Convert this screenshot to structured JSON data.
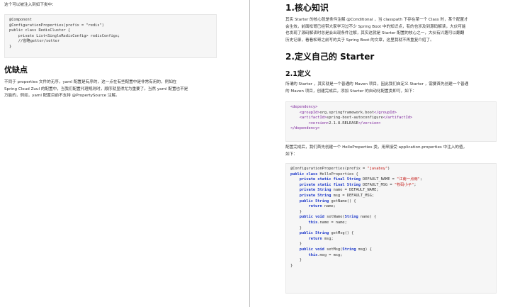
{
  "left": {
    "intro": "这个可以被注入到如下类中：",
    "code1": [
      "@Component",
      "@ConfigurationProperties(prefix = \"redis\")",
      "public class RedisCluster {",
      "    private List<SingleRedisConfig> redisConfigs;",
      "    //省略getter/setter",
      "}"
    ],
    "heading": "优缺点",
    "para_lines": [
      "不同于 properties 文件的无序，yaml 配置是有序的，这一点在有些配置中是非常有用的，例如在",
      "Spring Cloud Zuul 的配置中，当我们配置代理规则时，顺序就显得尤为重要了。当然 yaml 配置也不是",
      "万能的，例如，yaml 配置目前不支持 @PropertySource 注解。"
    ]
  },
  "right": {
    "h1_core": "1.核心知识",
    "core_lines": [
      "其实 Starter 的核心就是条件注解 @Conditional ，当 classpath 下存在某一个 Class 时，某个配置才",
      "会生效，前面松哥已经带大家学习过不少 Spring Boot 中的知识点，有的也涉及到源码解读，大伙可能",
      "也发现了源码解读时总是会出现条件注解，其实这就是 Starter 配置的核心之一，大伙有兴趣可以翻翻",
      "历史记录，看看松哥之前写的关于 Spring Boot 的文章，这里我就不再重复介绍了。"
    ],
    "h2_define": "2.定义自己的 Starter",
    "h3_define": "2.1定义",
    "define_lines": [
      "所谓的 Starter ，其实就是一个普通的 Maven 项目，因此我们自定义 Starter ，需要首先创建一个普通",
      "的 Maven 项目，创建完成后，添加 Starter 的自动化配置类即可，如下："
    ],
    "dep": {
      "open": "<dependency>",
      "close": "</dependency>",
      "groupId_open": "<groupId>",
      "groupId_value": "org.springframework.boot",
      "groupId_close": "</groupId>",
      "artifactId_open": "<artifactId>",
      "artifactId_value": "spring-boot-autoconfigure",
      "artifactId_close": "</artifactId>",
      "version_open": "<version>",
      "version_value": "2.1.8.RELEASE",
      "version_close": "</version>"
    },
    "after_lines": [
      "配置完成后，我们首先创建一个 HelloProperties 类，用来接受 application.properties 中注入的值，",
      "如下："
    ],
    "java": {
      "anno": "@ConfigurationProperties(prefix = ",
      "anno_str": "\"javaboy\"",
      "anno_end": ")",
      "kw_public": "public",
      "kw_class": "class",
      "kw_private": "private",
      "kw_static": "static",
      "kw_final": "final",
      "kw_void": "void",
      "kw_return": "return",
      "kw_this": "this",
      "class_name": "HelloProperties",
      "type_string": "String",
      "default_name": "DEFAULT_NAME",
      "default_name_val": "\"江南一点雨\"",
      "default_msg": "DEFAULT_MSG",
      "default_msg_val": "\"牧码小子\"",
      "field_name": "name",
      "field_msg": "msg",
      "get_name": "getName",
      "set_name": "setName",
      "get_msg": "getMsg",
      "set_msg": "setMsg",
      "open_brace": "{",
      "close_brace": "}"
    }
  }
}
